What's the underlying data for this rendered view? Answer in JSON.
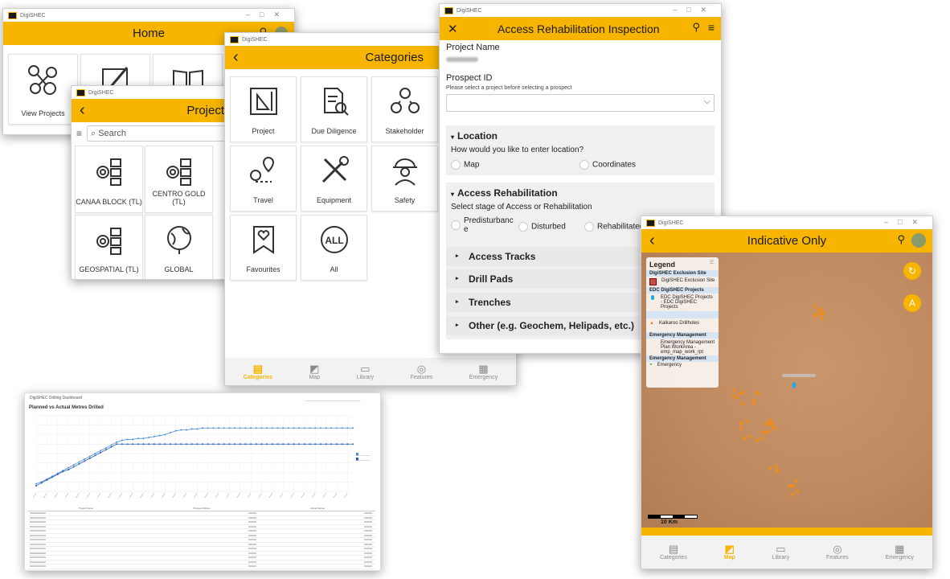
{
  "app_name": "DigiSHEC",
  "home": {
    "title": "Home",
    "tiles": [
      {
        "label": "View Projects"
      },
      {
        "label": ""
      },
      {
        "label": ""
      }
    ]
  },
  "projects": {
    "title": "Project",
    "search_placeholder": "Search",
    "tiles": [
      {
        "label": "CANAA BLOCK (TL)"
      },
      {
        "label": "CENTRO GOLD (TL)"
      },
      {
        "label": "GEOSPATIAL (TL)"
      },
      {
        "label": "GLOBAL"
      }
    ]
  },
  "categories": {
    "title": "Categories",
    "tiles": [
      {
        "label": "Project"
      },
      {
        "label": "Due Diligence"
      },
      {
        "label": "Stakeholder"
      },
      {
        "label": "Travel"
      },
      {
        "label": "Equipment"
      },
      {
        "label": "Safety"
      },
      {
        "label": "Favourites"
      },
      {
        "label": "All"
      }
    ],
    "nav": [
      {
        "label": "Categories",
        "icon": "categories-icon",
        "active": true
      },
      {
        "label": "Map",
        "icon": "map-icon",
        "active": false
      },
      {
        "label": "Library",
        "icon": "folder-icon",
        "active": false
      },
      {
        "label": "Features",
        "icon": "features-icon",
        "active": false
      },
      {
        "label": "Emergency",
        "icon": "emergency-icon",
        "active": false
      }
    ]
  },
  "inspection": {
    "title": "Access Rehabilitation Inspection",
    "project_name_label": "Project Name",
    "prospect_label": "Prospect ID",
    "prospect_hint": "Please select a project before selecting a prospect",
    "location_section": "Location",
    "location_question": "How would you like to enter location?",
    "location_options": [
      "Map",
      "Coordinates"
    ],
    "rehab_section": "Access Rehabilitation",
    "rehab_question": "Select stage of Access or Rehabilitation",
    "rehab_options": [
      "Predisturbanc\ne",
      "Disturbed",
      "Rehabilitated"
    ],
    "subsections": [
      "Access Tracks",
      "Drill Pads",
      "Trenches",
      "Other (e.g. Geochem, Helipads, etc.)"
    ]
  },
  "map_window": {
    "title": "Indicative Only",
    "legend_title": "Legend",
    "legend": {
      "g1": "DigiSHEC Exclusion Site",
      "g1_item": "DigiSHEC Exclusion Site",
      "g2": "EDC DigiSHEC Projects",
      "g2_item": "EDC DigiSHEC Projects - EDC DigiSHEC Projects",
      "g3_item": "Kalkaroo Drillholes",
      "g4": "Emergency Management",
      "g4_item": "Emergency Management Plan WorkArea - emp_map_work_rpt",
      "g5": "Emergency Management",
      "g5_item": "Emergency"
    },
    "scale_label": "10 Km",
    "nav": [
      {
        "label": "Categories",
        "active": false
      },
      {
        "label": "Map",
        "active": true
      },
      {
        "label": "Library",
        "active": false
      },
      {
        "label": "Features",
        "active": false
      },
      {
        "label": "Emergency",
        "active": false
      }
    ],
    "colors": {
      "accent": "#f7b500",
      "terrain": "#c79368",
      "points": "#f08c1a"
    }
  },
  "dashboard": {
    "window_title": "DigiSHEC Drilling Dashboard",
    "chart_title": "Planned vs Actual Metres Drilled",
    "table_headers": [
      "Project Name",
      "Planned Metres",
      "Actual Metres"
    ]
  },
  "chart_data": {
    "type": "line",
    "title": "Planned vs Actual Metres Drilled",
    "x": [
      1,
      2,
      3,
      4,
      5,
      6,
      7,
      8,
      9,
      10,
      11,
      12,
      13,
      14,
      15,
      16,
      17,
      18,
      19,
      20,
      21,
      22,
      23,
      24,
      25,
      26,
      27,
      28,
      29,
      30,
      31,
      32,
      33,
      34,
      35,
      36,
      37,
      38,
      39,
      40,
      41,
      42,
      43,
      44,
      45,
      46,
      47,
      48,
      49,
      50,
      51,
      52,
      53,
      54,
      55,
      56,
      57,
      58,
      59,
      60
    ],
    "series": [
      {
        "color": "#4f8fd8",
        "values": [
          8,
          10,
          13,
          16,
          19,
          22,
          25,
          28,
          31,
          34,
          37,
          40,
          43,
          46,
          49,
          52,
          54,
          55,
          55,
          56,
          56,
          57,
          58,
          59,
          60,
          62,
          64,
          65,
          65,
          66,
          66,
          67,
          67,
          67,
          67,
          67,
          67,
          67,
          67,
          67,
          67,
          67,
          67,
          67,
          67,
          67,
          67,
          67,
          67,
          67,
          67,
          67,
          67,
          67,
          67,
          67,
          67,
          67,
          67,
          67
        ]
      },
      {
        "color": "#2a5cb0",
        "values": [
          6,
          9,
          12,
          15,
          18,
          21,
          23,
          26,
          29,
          32,
          35,
          38,
          41,
          44,
          47,
          50,
          50,
          50,
          50,
          50,
          50,
          50,
          50,
          50,
          50,
          50,
          50,
          50,
          50,
          50,
          50,
          50,
          50,
          50,
          50,
          50,
          50,
          50,
          50,
          50,
          50,
          50,
          50,
          50,
          50,
          50,
          50,
          50,
          50,
          50,
          50,
          50,
          50,
          50,
          50,
          50,
          50,
          50,
          50,
          50
        ]
      }
    ],
    "ylim": [
      0,
      80
    ]
  }
}
